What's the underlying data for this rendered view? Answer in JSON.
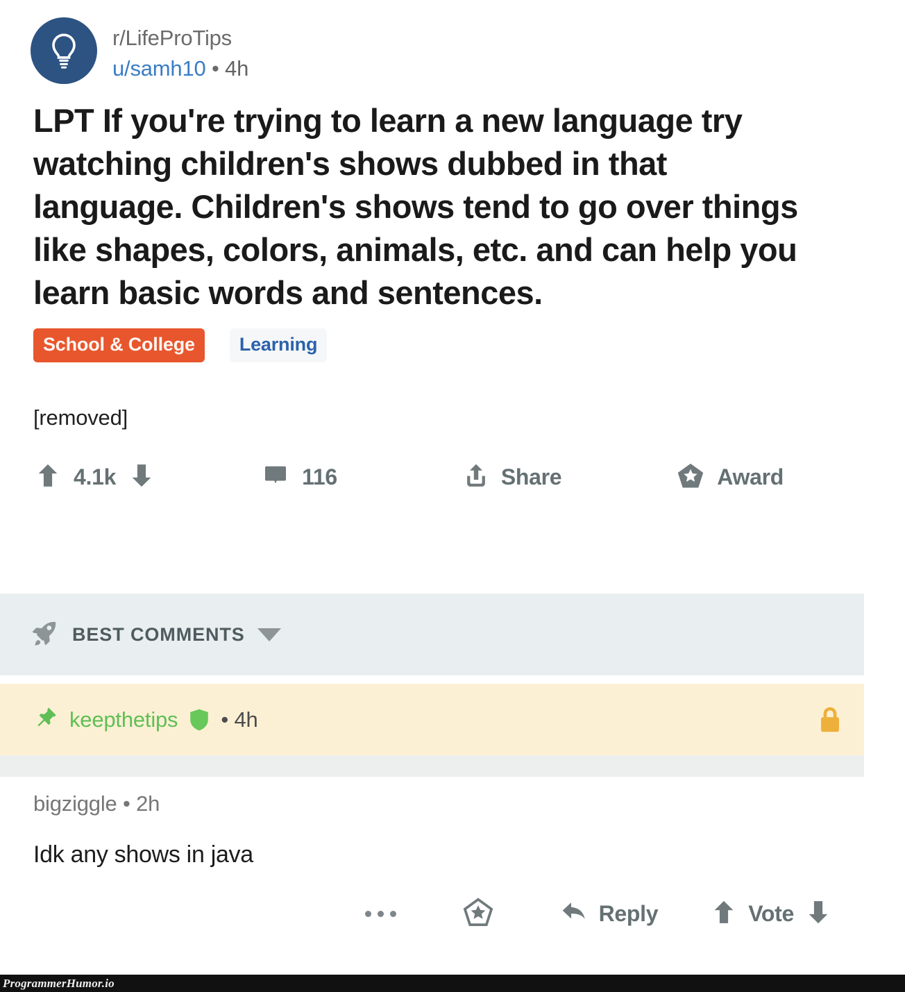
{
  "post": {
    "subreddit": "r/LifeProTips",
    "author": "u/samh10",
    "separator": "•",
    "timestamp": "4h",
    "title": "LPT If you're trying to learn a new language try watching children's shows dubbed in that language. Children's shows tend to go over things like shapes, colors, animals, etc. and can help you learn basic words and sentences.",
    "flairs": [
      {
        "label": "School & College",
        "style": "primary",
        "bg": "#e8562d",
        "fg": "#fdf6f2"
      },
      {
        "label": "Learning",
        "style": "secondary",
        "bg": "#f6f7f8",
        "fg": "#2b62ab"
      }
    ],
    "body": "[removed]",
    "avatar_icon": "lightbulb-icon",
    "avatar_bg": "#2d5383"
  },
  "post_actions": {
    "upvote_icon": "upvote-arrow-icon",
    "score": "4.1k",
    "downvote_icon": "downvote-arrow-icon",
    "comment_icon": "comment-bubble-icon",
    "comment_count": "116",
    "share_icon": "share-upload-icon",
    "share_label": "Share",
    "award_icon": "award-star-icon",
    "award_label": "Award"
  },
  "comments_header": {
    "icon": "rocket-icon",
    "label": "BEST COMMENTS",
    "caret_icon": "chevron-down-icon",
    "bg": "#e9eef0"
  },
  "pinned_comment": {
    "pin_icon": "pushpin-icon",
    "author": "keepthetips",
    "mod_badge_icon": "shield-icon",
    "separator": "•",
    "timestamp": "4h",
    "lock_icon": "lock-icon",
    "bg": "#fcf0d4",
    "author_color": "#5fbf55",
    "lock_color": "#edb03a"
  },
  "reply_comment": {
    "author": "bigziggle",
    "separator": "•",
    "timestamp": "2h",
    "text": "Idk any shows in java",
    "actions": {
      "more_icon": "ellipsis-icon",
      "award_icon": "award-star-icon",
      "reply_icon": "reply-arrow-icon",
      "reply_label": "Reply",
      "upvote_icon": "upvote-arrow-icon",
      "vote_label": "Vote",
      "downvote_icon": "downvote-arrow-icon"
    }
  },
  "watermark": {
    "text": "ProgrammerHumor.io",
    "bg": "#111111"
  }
}
